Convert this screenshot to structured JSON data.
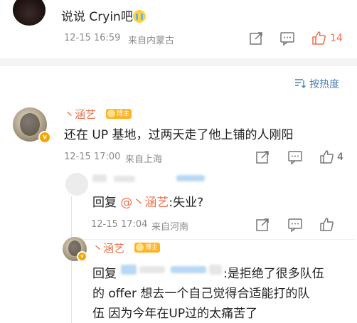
{
  "top_comment": {
    "text": "说说 Cryin吧",
    "emoji": "crying-face",
    "time": "12-15 16:59",
    "location": "来自内蒙古",
    "like_count": "14"
  },
  "sort_label": "按热度",
  "main_comment": {
    "username": "丶涵艺",
    "badge": "博主",
    "text": "还在 UP 基地，过两天走了他上铺的人刚阳",
    "time": "12-15 17:00",
    "location": "来自上海",
    "like_count": "4"
  },
  "reply_1": {
    "prefix": "回复",
    "mention": "@丶涵艺",
    "text": ":失业?",
    "time": "12-15 17:04",
    "location": "来自河南"
  },
  "reply_2": {
    "username": "丶涵艺",
    "badge": "博主",
    "prefix": "回复",
    "text_line1": ":是拒绝了很多队伍",
    "text_line2": "的 offer 想去一个自己觉得合适能打的队",
    "text_line3": "伍 因为今年在UP过的太痛苦了"
  },
  "colors": {
    "accent": "#eb7350",
    "like_active": "#eb7350",
    "meta": "#8a8a8a",
    "badge_bg": "#ffb326"
  }
}
